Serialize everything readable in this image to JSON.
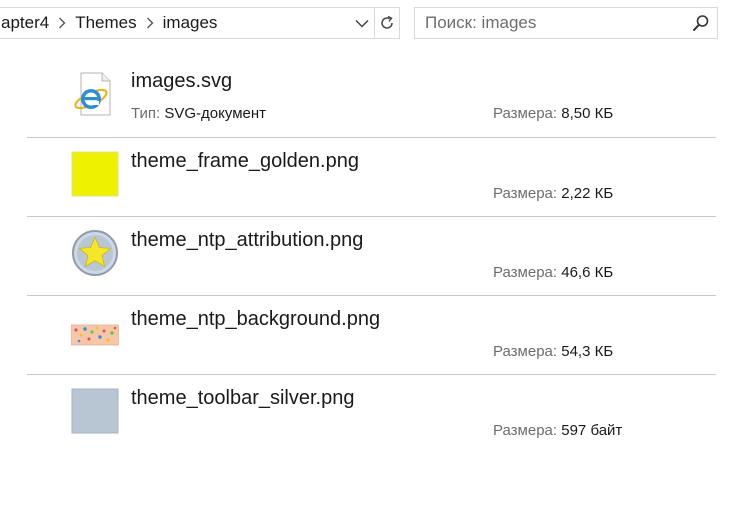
{
  "breadcrumb": {
    "items": [
      {
        "label": "apter4"
      },
      {
        "label": "Themes"
      },
      {
        "label": "images"
      }
    ]
  },
  "search": {
    "placeholder": "Поиск: images"
  },
  "meta_labels": {
    "type": "Тип:",
    "size": "Размера:"
  },
  "files": [
    {
      "name": "images.svg",
      "type": "SVG-документ",
      "size": "8,50 КБ",
      "icon": "ie-svg-document-icon"
    },
    {
      "name": "theme_frame_golden.png",
      "size": "2,22 КБ",
      "icon": "yellow-square-thumbnail",
      "thumb_color": "#eef200"
    },
    {
      "name": "theme_ntp_attribution.png",
      "size": "46,6 КБ",
      "icon": "star-badge-thumbnail",
      "thumb_color": "#f5e62a"
    },
    {
      "name": "theme_ntp_background.png",
      "size": "54,3 КБ",
      "icon": "dotted-peach-thumbnail",
      "thumb_color": "#f6c6a8"
    },
    {
      "name": "theme_toolbar_silver.png",
      "size": "597 байт",
      "icon": "gray-square-thumbnail",
      "thumb_color": "#b8c6d3"
    }
  ]
}
